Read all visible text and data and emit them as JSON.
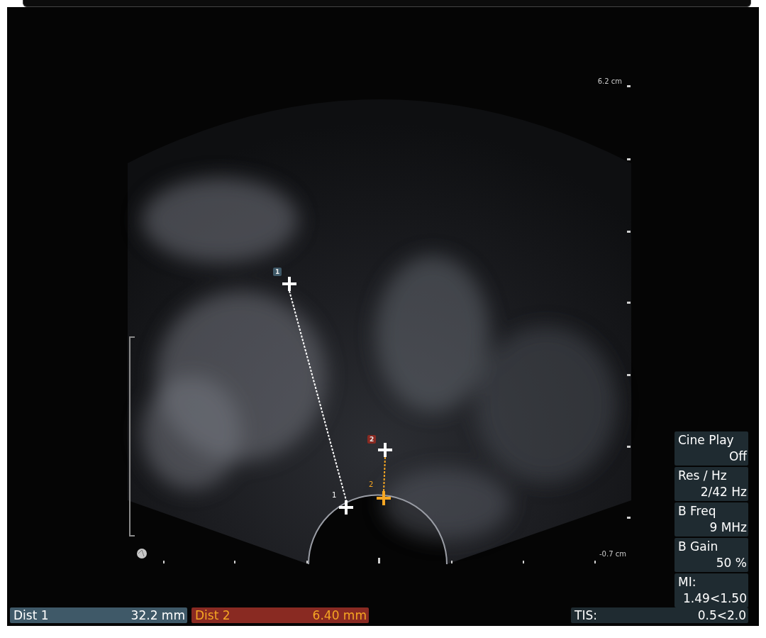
{
  "scale": {
    "top": "6.2 cm",
    "bottom": "-0.7 cm"
  },
  "measurements": [
    {
      "badge": "1",
      "end_label": "1",
      "label": "Dist 1",
      "value": "32.2 mm",
      "bar": {
        "color": "#3f5968"
      },
      "caliper": {
        "color": "#ffffff"
      }
    },
    {
      "badge": "2",
      "end_label": "2",
      "label": "Dist 2",
      "value": "6.40 mm",
      "bar": {
        "color": "#892a22"
      },
      "caliper": {
        "color": "#f5a623"
      }
    }
  ],
  "parameters": [
    {
      "label": "Cine Play",
      "value": "Off"
    },
    {
      "label": "Res / Hz",
      "value": "2/42 Hz"
    },
    {
      "label": "B Freq",
      "value": "9 MHz"
    },
    {
      "label": "B Gain",
      "value": "50 %"
    },
    {
      "label": "MI:",
      "value": "1.49<1.50"
    }
  ],
  "tis": {
    "label": "TIS:",
    "value": "0.5<2.0"
  }
}
